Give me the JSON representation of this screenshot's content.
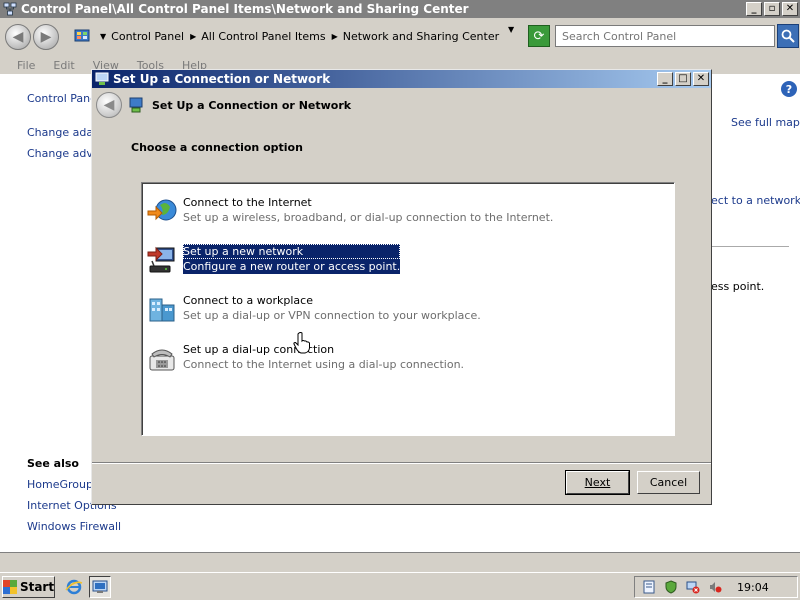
{
  "main_window": {
    "title": "Control Panel\\All Control Panel Items\\Network and Sharing Center",
    "controls": {
      "minimize": "_",
      "maximize": "▫",
      "close": "✕"
    }
  },
  "address_bar": {
    "crumbs": [
      "Control Panel",
      "All Control Panel Items",
      "Network and Sharing Center"
    ],
    "search_placeholder": "Search Control Panel"
  },
  "menu": [
    "File",
    "Edit",
    "View",
    "Tools",
    "Help"
  ],
  "left_panel": {
    "items": [
      "Control Panel Home",
      "Change adapter settings",
      "Change advanced sharing settings"
    ],
    "see_also_title": "See also",
    "see_also": [
      "HomeGroup",
      "Internet Options",
      "Windows Firewall"
    ]
  },
  "right_panel": {
    "see_full_map": "See full map",
    "connect_partial": "ect to a network",
    "access_point_partial": "ess point."
  },
  "dialog": {
    "title": "Set Up a Connection or Network",
    "header": "Set Up a Connection or Network",
    "prompt": "Choose a connection option",
    "options": [
      {
        "title": "Connect to the Internet",
        "description": "Set up a wireless, broadband, or dial-up connection to the Internet."
      },
      {
        "title": "Set up a new network",
        "description": "Configure a new router or access point."
      },
      {
        "title": "Connect to a workplace",
        "description": "Set up a dial-up or VPN connection to your workplace."
      },
      {
        "title": "Set up a dial-up connection",
        "description": "Connect to the Internet using a dial-up connection."
      }
    ],
    "selected_option": 1,
    "next_label": "Next",
    "cancel_label": "Cancel"
  },
  "taskbar": {
    "start_label": "Start",
    "clock": "19:04"
  },
  "colors": {
    "selection": "#0a246a",
    "title_gradient_start": "#0a246a",
    "link": "#1c3a8c",
    "disabled_text": "#6d6d6d"
  }
}
